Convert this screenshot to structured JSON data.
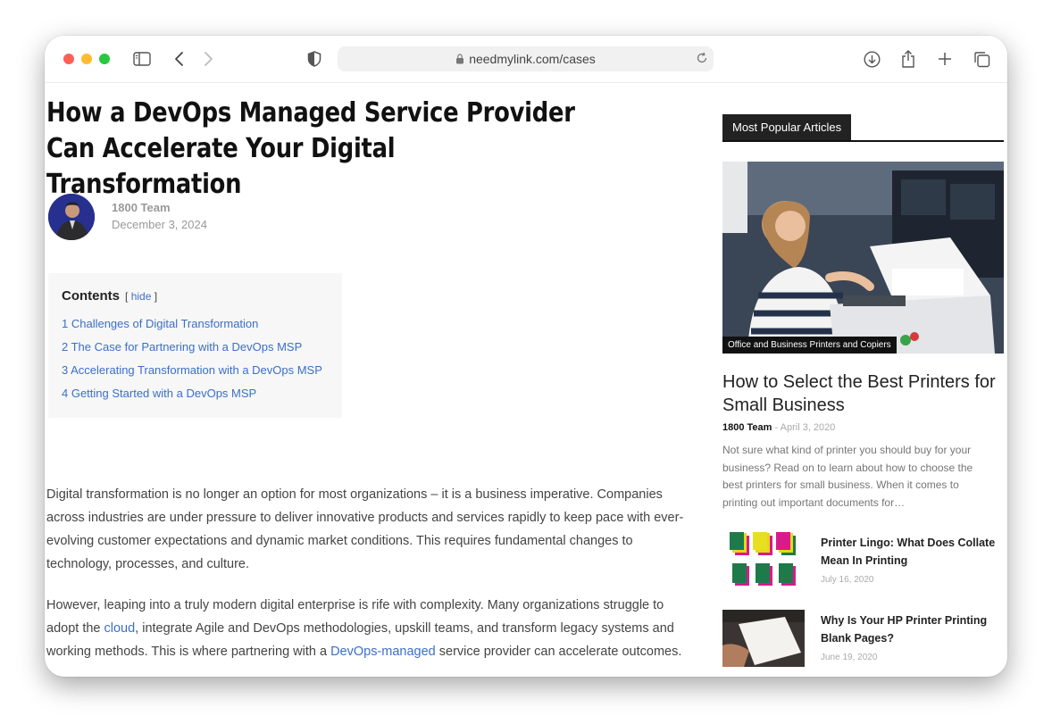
{
  "browser": {
    "url": "needmylink.com/cases"
  },
  "article": {
    "title": "How a DevOps Managed Service Provider Can Accelerate Your Digital Transformation",
    "author": "1800 Team",
    "date": "December 3, 2024",
    "toc": {
      "title": "Contents",
      "hide_open": "[",
      "hide_label": "hide",
      "hide_close": "]",
      "items": [
        "1  Challenges of Digital Transformation",
        "2  The Case for Partnering with a DevOps MSP",
        "3  Accelerating Transformation with a DevOps MSP",
        "4  Getting Started with a DevOps MSP"
      ]
    },
    "paragraph1": "Digital transformation is no longer an option for most organizations – it is a business imperative. Companies across industries are under pressure to deliver innovative products and services rapidly to keep pace with ever-evolving customer expectations and dynamic market conditions. This requires fundamental changes to technology, processes, and culture.",
    "paragraph2": {
      "part1": "However, leaping into a truly modern digital enterprise is rife with complexity. Many organizations struggle to adopt the ",
      "link1": "cloud",
      "part2": ", integrate Agile and DevOps methodologies, upskill teams, and transform legacy systems and working methods. This is where partnering with a ",
      "link2": "DevOps-managed",
      "part3": " service provider can accelerate outcomes."
    }
  },
  "sidebar": {
    "heading": "Most Popular Articles",
    "featured": {
      "category": "Office and Business  Printers and Copiers",
      "title": "How to Select the Best Printers for Small Business",
      "author": "1800 Team",
      "separator": "-",
      "date": "April 3, 2020",
      "excerpt": "Not sure what kind of printer you should buy for your business? Read on to learn about how to choose the best printers for small business. When it comes to printing out important documents for…"
    },
    "items": [
      {
        "title": "Printer Lingo: What Does Collate Mean In Printing",
        "date": "July 16, 2020"
      },
      {
        "title": "Why Is Your HP Printer Printing Blank Pages?",
        "date": "June 19, 2020"
      }
    ]
  },
  "colors": {
    "link": "#3b6fc7",
    "close": "#ff5f57",
    "minimize": "#febc2e",
    "zoom": "#28c840"
  }
}
